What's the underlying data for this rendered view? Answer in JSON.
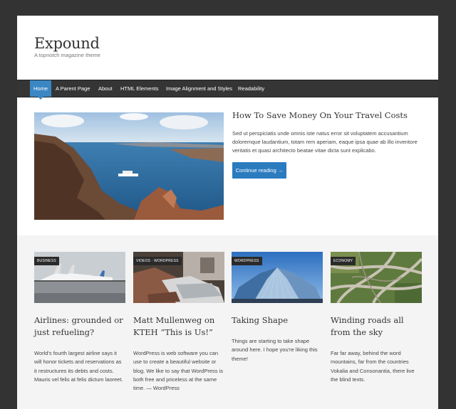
{
  "site": {
    "title": "Expound",
    "description": "A topnotch magazine theme"
  },
  "nav": {
    "items": [
      {
        "label": "Home",
        "active": true
      },
      {
        "label": "A Parent Page",
        "active": false
      },
      {
        "label": "About",
        "active": false
      },
      {
        "label": "HTML Elements",
        "active": false
      },
      {
        "label": "Image Alignment and Styles",
        "active": false
      },
      {
        "label": "Readability",
        "active": false
      }
    ]
  },
  "featured": {
    "title": "How To Save Money On Your Travel Costs",
    "excerpt": "Sed ut perspiciatis unde omnis iste natus error sit voluptatem accusantium doloremque laudantium, totam rem aperiam, eaque ipsa quae ab illo inventore veritatis et quasi architecto beatae vitae dicta sunt explicabo.",
    "button_label": "Continue reading →"
  },
  "posts": [
    {
      "category": "BUSINESS",
      "title": "Airlines: grounded or just refueling?",
      "excerpt": "World's fourth largest airline says it will honor tickets and reservations as it restructures its debts and costs. Mauris vel felis at felis dictum laoreet."
    },
    {
      "category": "VIDEOS · WORDPRESS",
      "title": "Matt Mullenweg on KTEH “This is Us!”",
      "excerpt": "WordPress is web software you can use to create a beautiful website or blog. We like to say that WordPress is both free and priceless at the same time. — WordPress"
    },
    {
      "category": "WORDPRESS",
      "title": "Taking Shape",
      "excerpt": "Things are starting to take shape around here. I hope you're liking this theme!"
    },
    {
      "category": "ECONOMY",
      "title": "Winding roads all from the sky",
      "excerpt": "Far far away, behind the word mountains, far from the countries Vokalia and Consonantia, there live the blind texts."
    }
  ],
  "colors": {
    "accent": "#3b87c4",
    "nav_background": "#353535",
    "outer_background": "#333333",
    "posts_background": "#f4f4f4"
  }
}
